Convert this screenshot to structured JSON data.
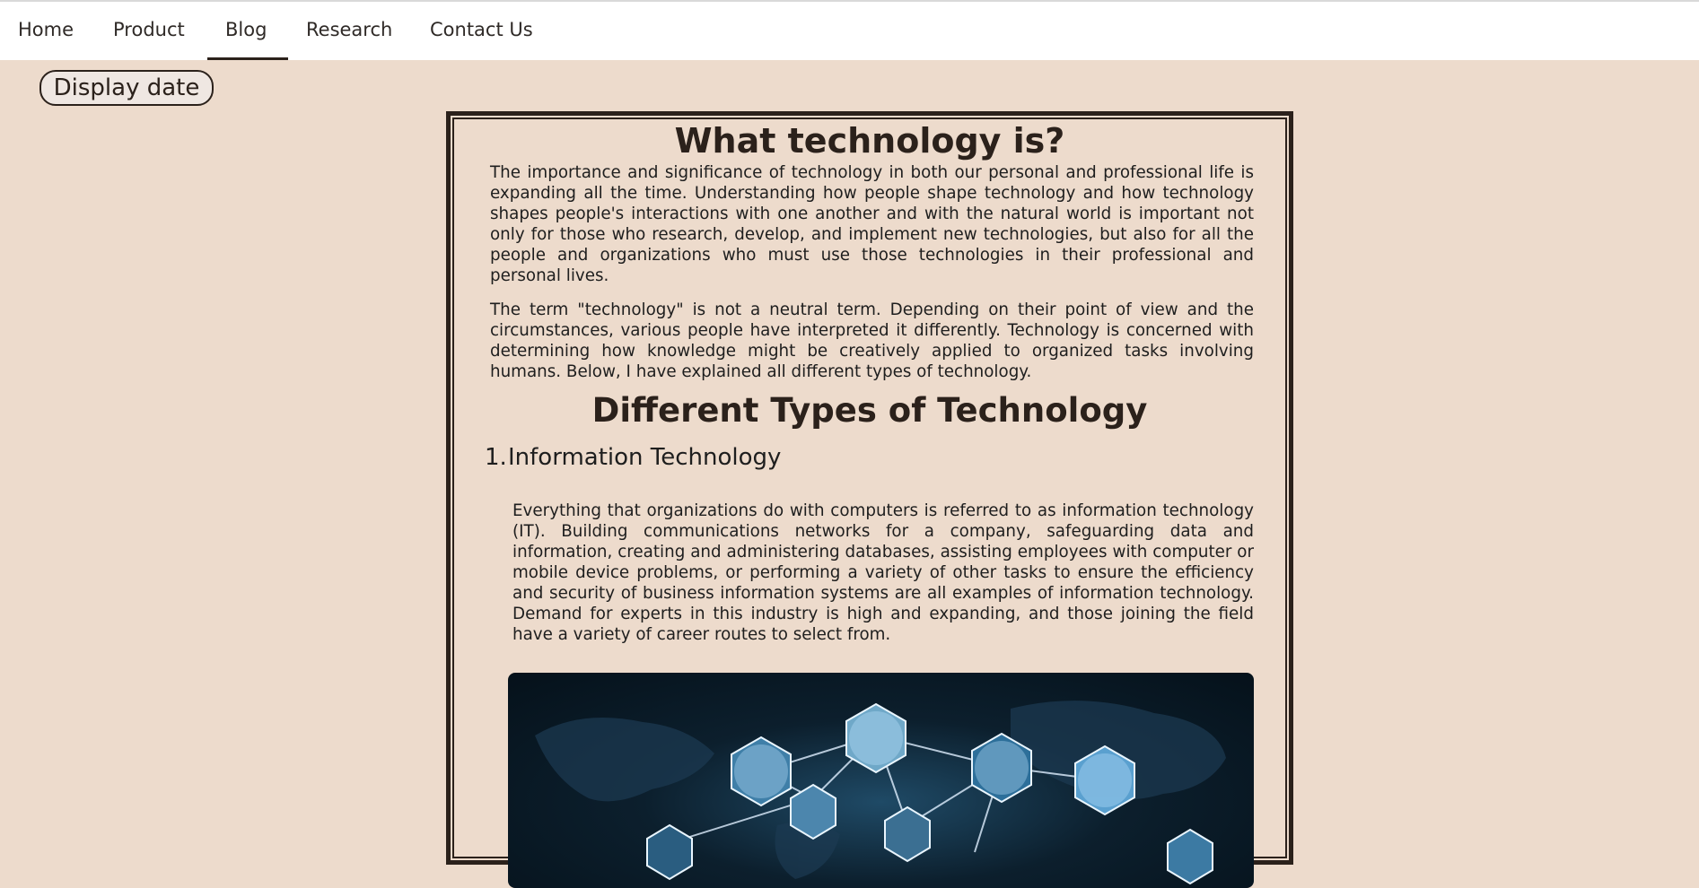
{
  "nav": {
    "items": [
      {
        "label": "Home"
      },
      {
        "label": "Product"
      },
      {
        "label": "Blog",
        "active": true
      },
      {
        "label": "Research"
      },
      {
        "label": "Contact Us"
      }
    ]
  },
  "display_date_button": "Display date",
  "article": {
    "title": "What technology is?",
    "paragraphs": [
      "The importance and significance of technology in both our personal and professional life is expanding all the time. Understanding how people shape technology and how technology shapes people's interactions with one another and with the natural world is important not only for those who research, develop, and implement new technologies, but also for all the people and organizations who must use those technologies in their professional and personal lives.",
      "The term \"technology\" is not a neutral term. Depending on their point of view and the circumstances, various people have interpreted it differently. Technology is concerned with determining how knowledge might be creatively applied to organized tasks involving humans. Below, I have explained all different types of technology."
    ],
    "section_title": "Different Types of Technology",
    "types": [
      {
        "number": "1.",
        "title": "Information Technology",
        "description": "Everything that organizations do with computers is referred to as information technology (IT). Building communications networks for a company, safeguarding data and information, creating and administering databases, assisting employees with computer or mobile device problems, or performing a variety of other tasks to ensure the efficiency and security of business information systems are all examples of information technology. Demand for experts in this industry is high and expanding, and those joining the field have a variety of career routes to select from."
      }
    ]
  },
  "colors": {
    "page_background": "#eddbcc",
    "nav_background": "#ffffff",
    "border": "#2b211b",
    "text": "#1e1e1e"
  }
}
